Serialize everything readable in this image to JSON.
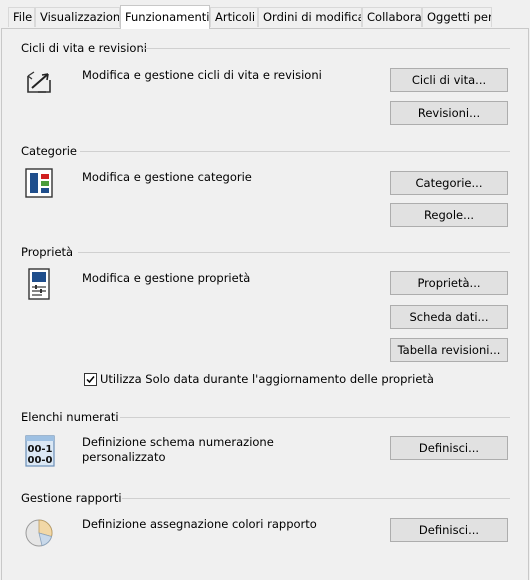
{
  "tabs": [
    {
      "label": "File",
      "active": false
    },
    {
      "label": "Visualizzazione",
      "active": false
    },
    {
      "label": "Funzionamenti",
      "active": true
    },
    {
      "label": "Articoli",
      "active": false
    },
    {
      "label": "Ordini di modifica",
      "active": false
    },
    {
      "label": "Collabora",
      "active": false
    },
    {
      "label": "Oggetti pers",
      "active": false
    }
  ],
  "sections": {
    "lifecycles": {
      "title": "Cicli di vita e revisioni",
      "description": "Modifica e gestione cicli di vita e revisioni",
      "icon": "lifecycle-icon",
      "buttons": [
        "Cicli di vita...",
        "Revisioni..."
      ]
    },
    "categories": {
      "title": "Categorie",
      "description": "Modifica e gestione categorie",
      "icon": "categories-icon",
      "buttons": [
        "Categorie...",
        "Regole..."
      ]
    },
    "properties": {
      "title": "Proprietà",
      "description": "Modifica e gestione proprietà",
      "icon": "properties-icon",
      "buttons": [
        "Proprietà...",
        "Scheda dati...",
        "Tabella revisioni..."
      ],
      "checkbox": {
        "label": "Utilizza Solo data durante l'aggiornamento delle proprietà",
        "checked": true
      }
    },
    "numbering": {
      "title": "Elenchi numerati",
      "description": "Definizione schema numerazione personalizzato",
      "icon": "numbering-icon",
      "icon_text_top": "00-1",
      "icon_text_bottom": "00-0",
      "buttons": [
        "Definisci..."
      ]
    },
    "reports": {
      "title": "Gestione rapporti",
      "description": "Definizione assegnazione colori rapporto",
      "icon": "pie-chart-icon",
      "buttons": [
        "Definisci..."
      ]
    }
  },
  "colors": {
    "background": "#f0f0f0",
    "button_face": "#e1e1e1",
    "button_border": "#adadad",
    "separator": "#d0d0d0"
  }
}
